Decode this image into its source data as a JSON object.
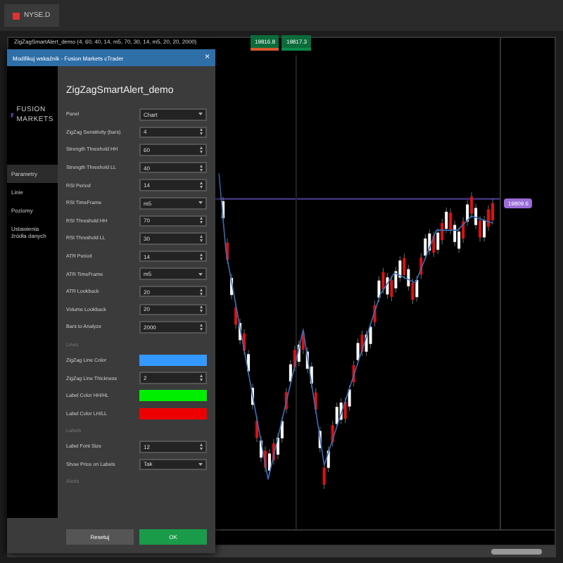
{
  "tab": {
    "label": "NYSE.D"
  },
  "chart": {
    "title": "ZigZagSmartAlert_demo (4, 60, 40, 14, m5, 70, 30, 14, m5, 20, 20, 2000)",
    "sell_price": "19816.8",
    "buy_price": "19817.3",
    "current_price": "19809.6"
  },
  "dialog": {
    "title": "Modifikuj wskaźnik - Fusion Markets cTrader",
    "close": "×",
    "logo": [
      "FUSION",
      "MARKETS"
    ],
    "indicator_name": "ZigZagSmartAlert_demo",
    "sidebar": [
      {
        "label": "Parametry",
        "selected": true
      },
      {
        "label": "Linie",
        "selected": false
      },
      {
        "label": "Poziomy",
        "selected": false
      },
      {
        "label": "Ustawienia źródła danych",
        "selected": false
      }
    ],
    "sections": [
      {
        "params": [
          {
            "label": "Panel",
            "kind": "select",
            "value": "Chart"
          },
          {
            "label": "ZigZag Sensitivity (bars)",
            "kind": "number",
            "value": "4"
          },
          {
            "label": "Strength Threshold HH",
            "kind": "number",
            "value": "60"
          },
          {
            "label": "Strength Threshold LL",
            "kind": "number",
            "value": "40"
          },
          {
            "label": "RSI Period",
            "kind": "number",
            "value": "14"
          },
          {
            "label": "RSI TimeFrame",
            "kind": "select",
            "value": "m5"
          },
          {
            "label": "RSI Threshold HH",
            "kind": "number",
            "value": "70"
          },
          {
            "label": "RSI Threshold LL",
            "kind": "number",
            "value": "30"
          },
          {
            "label": "ATR Period",
            "kind": "number",
            "value": "14"
          },
          {
            "label": "ATR TimeFrame",
            "kind": "select",
            "value": "m5"
          },
          {
            "label": "ATR Lookback",
            "kind": "number",
            "value": "20"
          },
          {
            "label": "Volume Lookback",
            "kind": "number",
            "value": "20"
          },
          {
            "label": "Bars to Analyze",
            "kind": "number",
            "value": "2000"
          }
        ]
      },
      {
        "heading": "Lines",
        "params": [
          {
            "label": "ZigZag Line Color",
            "kind": "color",
            "color": "#3399ff"
          },
          {
            "label": "ZigZag Line Thickness",
            "kind": "number",
            "value": "2"
          },
          {
            "label": "Label Color HH/HL",
            "kind": "color",
            "color": "#00ee00"
          },
          {
            "label": "Label Color LH/LL",
            "kind": "color",
            "color": "#ee0000"
          }
        ]
      },
      {
        "heading": "Labels",
        "params": [
          {
            "label": "Label Font Size",
            "kind": "number",
            "value": "12"
          },
          {
            "label": "Show Price on Labels",
            "kind": "select",
            "value": "Tak"
          }
        ]
      },
      {
        "heading": "Alerts"
      }
    ],
    "buttons": [
      {
        "label": "Resetuj",
        "kind": "secondary"
      },
      {
        "label": "OK",
        "kind": "primary"
      }
    ]
  }
}
